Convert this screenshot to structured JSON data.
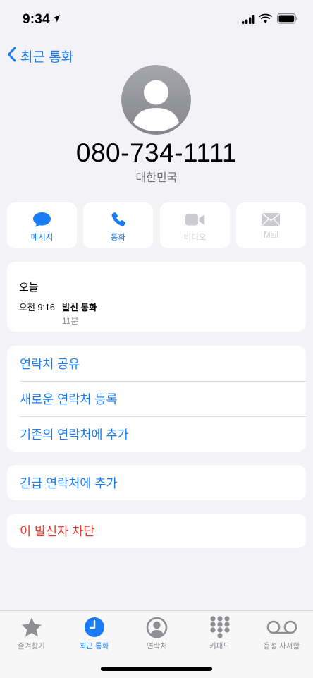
{
  "status": {
    "time": "9:34"
  },
  "nav": {
    "back_label": "최근 통화"
  },
  "contact": {
    "phone_number": "080-734-1111",
    "country": "대한민국"
  },
  "actions": [
    {
      "label": "메시지",
      "icon": "message-bubble-icon",
      "enabled": true
    },
    {
      "label": "통화",
      "icon": "phone-icon",
      "enabled": true
    },
    {
      "label": "비디오",
      "icon": "video-camera-icon",
      "enabled": false
    },
    {
      "label": "Mail",
      "icon": "mail-envelope-icon",
      "enabled": false
    }
  ],
  "recent": {
    "heading": "오늘",
    "time": "오전 9:16",
    "type": "발신 통화",
    "duration": "11분"
  },
  "options": [
    {
      "label": "연락처 공유"
    },
    {
      "label": "새로운 연락처 등록"
    },
    {
      "label": "기존의 연락처에 추가"
    }
  ],
  "emergency_label": "긴급 연락처에 추가",
  "block_label": "이 발신자 차단",
  "tabs": [
    {
      "label": "즐겨찾기",
      "icon": "star-icon",
      "active": false
    },
    {
      "label": "최근 통화",
      "icon": "clock-icon",
      "active": true
    },
    {
      "label": "연락처",
      "icon": "person-circle-icon",
      "active": false
    },
    {
      "label": "키패드",
      "icon": "keypad-icon",
      "active": false
    },
    {
      "label": "음성 사서함",
      "icon": "voicemail-icon",
      "active": false
    }
  ],
  "colors": {
    "accent": "#1a7cf5",
    "destructive": "#eb3b30",
    "background": "#f2f2f7",
    "secondary_text": "#8e8e93"
  }
}
